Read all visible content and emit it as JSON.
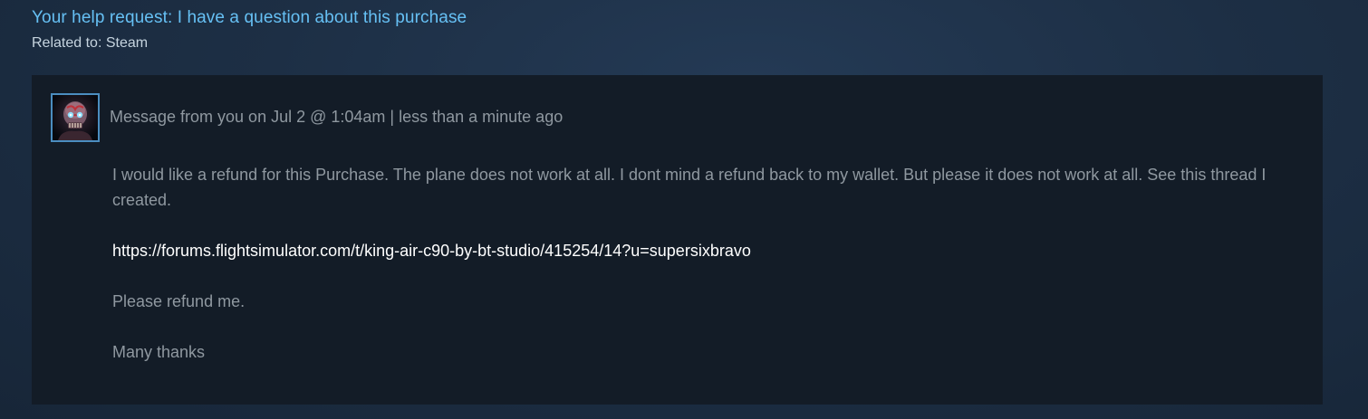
{
  "header": {
    "title": "Your help request: I have a question about this purchase",
    "related_label": "Related to:",
    "related_value": "Steam"
  },
  "message": {
    "avatar_icon": "skull-avatar-icon",
    "meta": "Message from you on Jul 2 @ 1:04am | less than a minute ago",
    "paragraph1": "I would like a refund for this Purchase. The plane does not work at all. I dont mind a refund back to my wallet. But please it does not work at all. See this thread I created.",
    "link": "https://forums.flightsimulator.com/t/king-air-c90-by-bt-studio/415254/14?u=supersixbravo",
    "paragraph2": "Please refund me.",
    "paragraph3": "Many thanks"
  },
  "colors": {
    "title": "#66c0f4",
    "panel_bg": "#131c27",
    "body_text": "#8f98a0",
    "link": "#ffffff",
    "avatar_border": "#4b8dc0"
  }
}
